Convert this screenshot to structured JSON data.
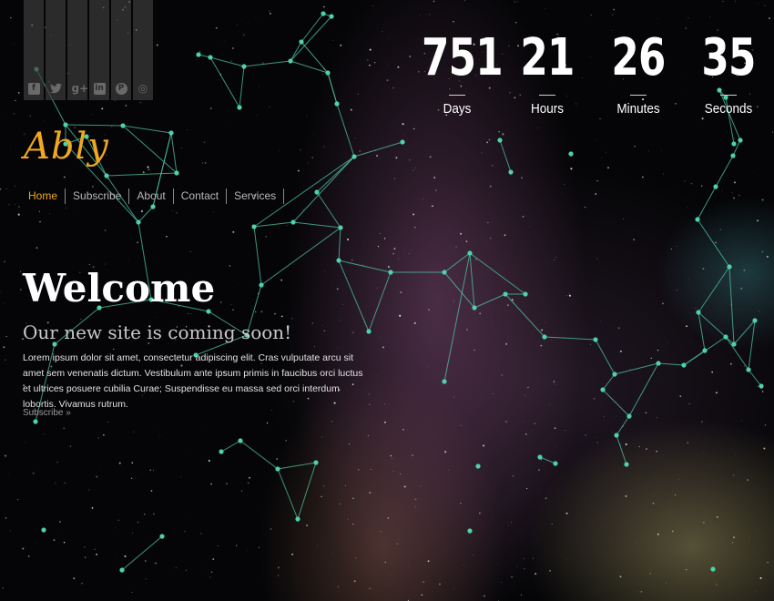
{
  "social": [
    {
      "name": "facebook-icon",
      "glyph": "f"
    },
    {
      "name": "twitter-icon",
      "glyph": "🐦"
    },
    {
      "name": "google-plus-icon",
      "glyph": "g+"
    },
    {
      "name": "linkedin-icon",
      "glyph": "in"
    },
    {
      "name": "pinterest-icon",
      "glyph": "P"
    },
    {
      "name": "dribbble-icon",
      "glyph": "◎"
    }
  ],
  "logo": "Ably",
  "nav": {
    "items": [
      "Home",
      "Subscribe",
      "About",
      "Contact",
      "Services"
    ],
    "active": "Home"
  },
  "hero": {
    "title": "Welcome",
    "subtitle": "Our new site is coming soon!",
    "body": "Lorem ipsum dolor sit amet, consectetur adipiscing elit. Cras vulputate arcu sit amet sem venenatis dictum. Vestibulum ante ipsum primis in faucibus orci luctus et ultrices posuere cubilia Curae; Suspendisse eu massa sed orci interdum lobortis. Vivamus rutrum.",
    "link": "Subscribe »"
  },
  "countdown": [
    {
      "value": "751",
      "label": "Days"
    },
    {
      "value": "21",
      "label": "Hours"
    },
    {
      "value": "26",
      "label": "Minutes"
    },
    {
      "value": "35",
      "label": "Seconds"
    }
  ],
  "colors": {
    "accent": "#f0a820",
    "network": "#4fc7a6"
  }
}
